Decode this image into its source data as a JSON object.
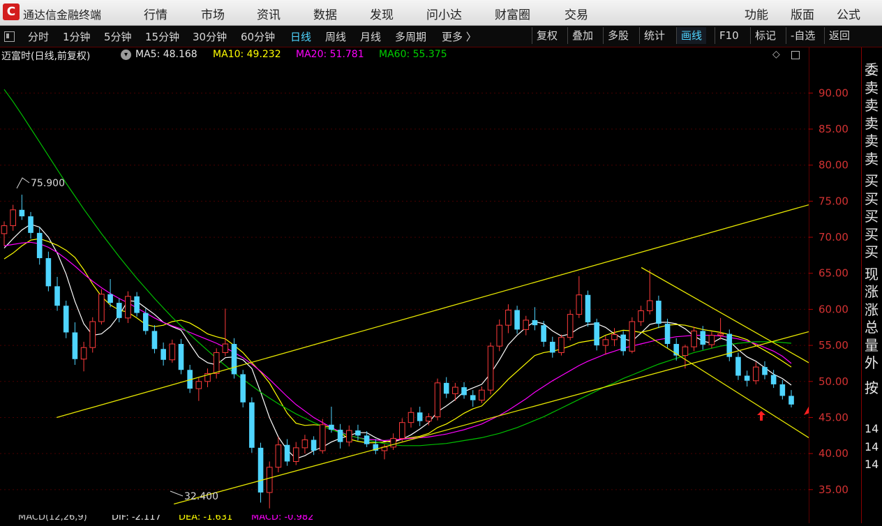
{
  "app": {
    "logo_glyph": "C",
    "title": "通达信金融终端"
  },
  "menu": [
    "行情",
    "市场",
    "资讯",
    "数据",
    "发现",
    "问小达",
    "财富圈",
    "交易",
    "功能",
    "版面",
    "公式"
  ],
  "periods": [
    "分时",
    "1分钟",
    "5分钟",
    "15分钟",
    "30分钟",
    "60分钟",
    "日线",
    "周线",
    "月线",
    "多周期",
    "更多 〉"
  ],
  "active_period": "日线",
  "tools": [
    "复权",
    "叠加",
    "多股",
    "统计",
    "画线",
    "F10",
    "标记",
    "-自选",
    "返回"
  ],
  "active_tool": "画线",
  "info": {
    "stock_label": "迈富时(日线,前复权)",
    "ma5": "MA5: 48.168",
    "ma10": "MA10: 49.232",
    "ma20": "MA20: 51.781",
    "ma60": "MA60: 55.375"
  },
  "colors": {
    "up": "#ff3b3b",
    "down": "#4fd5ff",
    "ma5": "#ffffff",
    "ma10": "#ffff00",
    "ma20": "#ff00ff",
    "ma60": "#00c000",
    "trendline": "#e6e600",
    "arrow": "#ff2020",
    "axis": "#b00000"
  },
  "annotations": {
    "high": "75.900",
    "low": "32.400"
  },
  "y_axis": {
    "ticks": [
      "90.00",
      "85.00",
      "80.00",
      "75.00",
      "70.00",
      "65.00",
      "60.00",
      "55.00",
      "50.00",
      "45.00",
      "40.00",
      "35.00"
    ],
    "min": 31.5,
    "max": 94
  },
  "side_panel": [
    "委",
    "卖",
    "卖",
    "卖",
    "卖",
    "卖",
    "买",
    "买",
    "买",
    "买",
    "买",
    "现",
    "涨",
    "涨",
    "总",
    "量",
    "外",
    "按",
    "14",
    "14",
    "14"
  ],
  "bottom": {
    "macd": "MACD(12,26,9)",
    "dif": "DIF: -2.117",
    "dea": "DEA: -1.631",
    "macd_val": "MACD: -0.982"
  },
  "chart_data": {
    "type": "candlestick",
    "title": "迈富时(日线,前复权)",
    "candles_ohlc": [
      [
        70.5,
        72.2,
        68.8,
        71.6
      ],
      [
        71.6,
        74.5,
        70.9,
        73.8
      ],
      [
        73.8,
        75.9,
        72.4,
        72.9
      ],
      [
        72.9,
        73.5,
        69.8,
        70.6
      ],
      [
        70.6,
        71.4,
        66.2,
        67.1
      ],
      [
        67.1,
        68.0,
        62.5,
        63.2
      ],
      [
        63.2,
        64.5,
        59.8,
        60.5
      ],
      [
        60.5,
        61.2,
        56.0,
        56.8
      ],
      [
        56.8,
        58.2,
        52.3,
        53.1
      ],
      [
        53.1,
        55.5,
        51.4,
        54.7
      ],
      [
        54.7,
        58.9,
        54.0,
        58.3
      ],
      [
        58.3,
        62.8,
        57.9,
        62.1
      ],
      [
        62.1,
        64.2,
        60.3,
        60.9
      ],
      [
        60.9,
        61.5,
        58.2,
        58.8
      ],
      [
        58.8,
        62.5,
        58.1,
        61.8
      ],
      [
        61.8,
        62.4,
        59.0,
        59.5
      ],
      [
        59.5,
        60.1,
        56.5,
        57.0
      ],
      [
        57.0,
        57.8,
        53.9,
        54.5
      ],
      [
        54.5,
        55.4,
        52.2,
        53.0
      ],
      [
        53.0,
        55.8,
        52.6,
        55.2
      ],
      [
        55.2,
        55.9,
        51.0,
        51.6
      ],
      [
        51.6,
        52.3,
        48.4,
        49.0
      ],
      [
        49.0,
        50.5,
        47.3,
        50.0
      ],
      [
        50.0,
        51.8,
        49.2,
        51.1
      ],
      [
        51.1,
        54.6,
        50.4,
        54.0
      ],
      [
        54.0,
        60.1,
        53.5,
        55.2
      ],
      [
        55.2,
        56.0,
        50.4,
        51.0
      ],
      [
        51.0,
        51.6,
        46.4,
        47.1
      ],
      [
        47.1,
        47.8,
        40.1,
        40.8
      ],
      [
        40.8,
        41.5,
        33.2,
        34.6
      ],
      [
        34.6,
        38.9,
        32.4,
        38.1
      ],
      [
        38.1,
        42.3,
        37.4,
        41.2
      ],
      [
        41.2,
        42.0,
        38.3,
        38.9
      ],
      [
        38.9,
        41.6,
        38.4,
        40.8
      ],
      [
        40.8,
        42.6,
        40.0,
        41.9
      ],
      [
        41.9,
        42.4,
        39.8,
        40.4
      ],
      [
        40.4,
        44.8,
        40.0,
        44.0
      ],
      [
        44.0,
        46.5,
        42.9,
        43.3
      ],
      [
        43.3,
        44.1,
        40.7,
        41.6
      ],
      [
        41.6,
        43.9,
        41.0,
        43.2
      ],
      [
        43.2,
        44.0,
        41.8,
        42.5
      ],
      [
        42.5,
        43.1,
        40.9,
        41.3
      ],
      [
        41.3,
        42.0,
        39.9,
        40.4
      ],
      [
        40.4,
        41.3,
        39.2,
        40.9
      ],
      [
        40.9,
        42.8,
        40.5,
        42.1
      ],
      [
        42.1,
        44.9,
        41.7,
        44.3
      ],
      [
        44.3,
        46.4,
        43.6,
        45.7
      ],
      [
        45.7,
        46.5,
        43.8,
        44.5
      ],
      [
        44.5,
        45.6,
        43.9,
        45.1
      ],
      [
        45.1,
        50.4,
        44.6,
        49.8
      ],
      [
        49.8,
        50.6,
        47.7,
        48.3
      ],
      [
        48.3,
        49.8,
        47.3,
        49.2
      ],
      [
        49.2,
        49.9,
        47.6,
        48.1
      ],
      [
        48.1,
        48.8,
        46.5,
        47.4
      ],
      [
        47.4,
        49.3,
        47.0,
        48.8
      ],
      [
        48.8,
        55.4,
        48.2,
        54.9
      ],
      [
        54.9,
        58.6,
        54.2,
        57.8
      ],
      [
        57.8,
        60.7,
        56.7,
        59.9
      ],
      [
        59.9,
        60.5,
        56.6,
        57.2
      ],
      [
        57.2,
        59.1,
        56.4,
        58.5
      ],
      [
        58.5,
        60.3,
        57.1,
        57.8
      ],
      [
        57.8,
        58.4,
        54.8,
        55.5
      ],
      [
        55.5,
        56.2,
        53.3,
        54.0
      ],
      [
        54.0,
        56.5,
        53.6,
        56.1
      ],
      [
        56.1,
        59.9,
        55.7,
        59.3
      ],
      [
        59.3,
        64.6,
        58.8,
        62.0
      ],
      [
        62.0,
        62.6,
        57.6,
        58.2
      ],
      [
        58.2,
        58.7,
        54.3,
        55.0
      ],
      [
        55.0,
        56.3,
        53.7,
        55.8
      ],
      [
        55.8,
        57.4,
        54.9,
        56.5
      ],
      [
        56.5,
        57.0,
        53.6,
        54.2
      ],
      [
        54.2,
        58.9,
        53.9,
        58.3
      ],
      [
        58.3,
        60.5,
        57.7,
        59.8
      ],
      [
        59.8,
        65.5,
        59.3,
        61.2
      ],
      [
        61.2,
        61.9,
        57.4,
        58.0
      ],
      [
        58.0,
        58.7,
        54.6,
        55.2
      ],
      [
        55.2,
        56.0,
        52.9,
        53.6
      ],
      [
        53.6,
        55.1,
        51.8,
        54.8
      ],
      [
        54.8,
        57.6,
        54.2,
        57.0
      ],
      [
        57.0,
        57.7,
        54.4,
        55.1
      ],
      [
        55.1,
        56.9,
        54.6,
        56.4
      ],
      [
        56.4,
        58.8,
        55.8,
        56.6
      ],
      [
        56.6,
        57.2,
        52.8,
        53.4
      ],
      [
        53.4,
        54.0,
        50.2,
        50.8
      ],
      [
        50.8,
        51.5,
        49.3,
        50.1
      ],
      [
        50.1,
        52.7,
        49.6,
        52.0
      ],
      [
        52.0,
        52.8,
        50.3,
        50.9
      ],
      [
        50.9,
        51.6,
        49.1,
        49.6
      ],
      [
        49.6,
        50.2,
        47.5,
        48.0
      ],
      [
        48.0,
        48.8,
        46.4,
        46.8
      ]
    ],
    "series": [
      {
        "name": "MA5",
        "values": [
          68.5,
          69.8,
          71.0,
          71.8,
          71.4,
          70.0,
          67.8,
          64.9,
          61.1,
          58.0,
          56.4,
          56.6,
          57.6,
          59.2,
          61.2,
          61.1,
          60.2,
          59.3,
          58.2,
          57.6,
          57.1,
          55.2,
          53.4,
          52.6,
          52.3,
          53.3,
          53.4,
          53.0,
          51.8,
          48.5,
          45.0,
          42.3,
          40.5,
          39.3,
          39.7,
          40.4,
          40.9,
          41.6,
          42.1,
          42.5,
          42.9,
          42.9,
          42.2,
          41.7,
          41.6,
          42.0,
          42.6,
          43.4,
          44.3,
          45.8,
          46.6,
          47.5,
          48.6,
          49.1,
          49.6,
          51.1,
          53.0,
          55.1,
          56.4,
          57.5,
          58.3,
          58.0,
          57.0,
          56.3,
          56.6,
          57.4,
          57.9,
          58.0,
          57.5,
          56.6,
          55.9,
          55.6,
          56.7,
          57.9,
          58.2,
          58.2,
          58.0,
          57.3,
          56.3,
          55.6,
          55.3,
          56.0,
          55.6,
          54.4,
          53.4,
          52.8,
          51.9,
          51.0,
          50.4,
          49.5
        ]
      },
      {
        "name": "MA10",
        "values": [
          67.0,
          67.8,
          68.8,
          69.6,
          69.8,
          69.4,
          68.9,
          68.2,
          67.2,
          65.5,
          63.5,
          61.8,
          60.6,
          59.9,
          59.6,
          58.8,
          57.9,
          57.6,
          57.8,
          58.3,
          58.5,
          58.1,
          57.4,
          56.6,
          56.2,
          55.9,
          55.0,
          54.0,
          52.6,
          51.3,
          49.8,
          47.7,
          45.6,
          44.2,
          43.9,
          44.0,
          43.9,
          43.6,
          42.9,
          42.0,
          41.7,
          41.5,
          41.5,
          41.6,
          41.8,
          42.0,
          42.2,
          42.4,
          42.8,
          43.6,
          44.1,
          44.8,
          45.6,
          46.2,
          46.6,
          47.8,
          49.0,
          50.3,
          51.4,
          52.5,
          53.6,
          54.0,
          54.2,
          54.5,
          54.9,
          55.4,
          55.6,
          55.8,
          56.4,
          56.8,
          57.1,
          57.0,
          56.8,
          57.1,
          57.5,
          57.8,
          57.9,
          57.8,
          57.5,
          57.2,
          57.0,
          56.8,
          56.5,
          56.2,
          55.8,
          55.0,
          54.3,
          53.6,
          52.8,
          52.0
        ]
      },
      {
        "name": "MA20",
        "values": [
          68.8,
          69.0,
          69.2,
          69.3,
          69.1,
          68.6,
          67.9,
          67.0,
          66.0,
          64.9,
          63.9,
          63.0,
          62.2,
          61.5,
          60.9,
          60.2,
          59.5,
          58.8,
          58.2,
          57.7,
          57.3,
          56.8,
          56.3,
          55.8,
          55.3,
          54.7,
          54.0,
          53.3,
          52.4,
          51.4,
          50.3,
          49.1,
          47.9,
          46.8,
          45.9,
          45.0,
          44.3,
          43.6,
          43.0,
          42.5,
          42.2,
          42.0,
          41.9,
          41.8,
          41.9,
          42.0,
          42.1,
          42.2,
          42.3,
          42.5,
          42.7,
          43.0,
          43.3,
          43.7,
          44.1,
          44.7,
          45.3,
          46.0,
          46.8,
          47.6,
          48.5,
          49.3,
          50.1,
          50.8,
          51.5,
          52.2,
          52.8,
          53.3,
          53.8,
          54.2,
          54.6,
          54.9,
          55.2,
          55.5,
          55.8,
          56.0,
          56.2,
          56.3,
          56.4,
          56.4,
          56.4,
          56.3,
          56.1,
          55.9,
          55.6,
          55.2,
          54.7,
          54.2,
          53.5,
          52.5
        ]
      },
      {
        "name": "MA60",
        "values": [
          90.5,
          88.8,
          87.0,
          85.1,
          83.2,
          81.3,
          79.4,
          77.5,
          75.7,
          73.9,
          72.2,
          70.5,
          68.9,
          67.3,
          65.8,
          64.3,
          62.9,
          61.5,
          60.2,
          58.9,
          57.7,
          56.5,
          55.4,
          54.3,
          53.2,
          52.2,
          51.2,
          50.3,
          49.4,
          48.5,
          47.7,
          46.9,
          46.2,
          45.5,
          44.9,
          44.3,
          43.8,
          43.3,
          42.9,
          42.5,
          42.2,
          41.9,
          41.6,
          41.4,
          41.2,
          41.1,
          41.1,
          41.1,
          41.2,
          41.3,
          41.4,
          41.6,
          41.8,
          42.0,
          42.2,
          42.5,
          42.8,
          43.2,
          43.6,
          44.1,
          44.6,
          45.1,
          45.7,
          46.3,
          46.9,
          47.5,
          48.1,
          48.7,
          49.3,
          49.8,
          50.4,
          50.9,
          51.4,
          51.9,
          52.4,
          52.8,
          53.2,
          53.6,
          54.0,
          54.3,
          54.6,
          54.9,
          55.1,
          55.3,
          55.4,
          55.5,
          55.5,
          55.5,
          55.4,
          55.3
        ]
      }
    ],
    "trendlines": [
      [
        0.07,
        45.0,
        1.0,
        74.5
      ],
      [
        0.215,
        33.0,
        1.0,
        56.9
      ],
      [
        0.793,
        65.8,
        1.0,
        52.6
      ],
      [
        0.793,
        56.9,
        1.0,
        42.2
      ]
    ],
    "y_range": [
      31.5,
      94
    ]
  }
}
